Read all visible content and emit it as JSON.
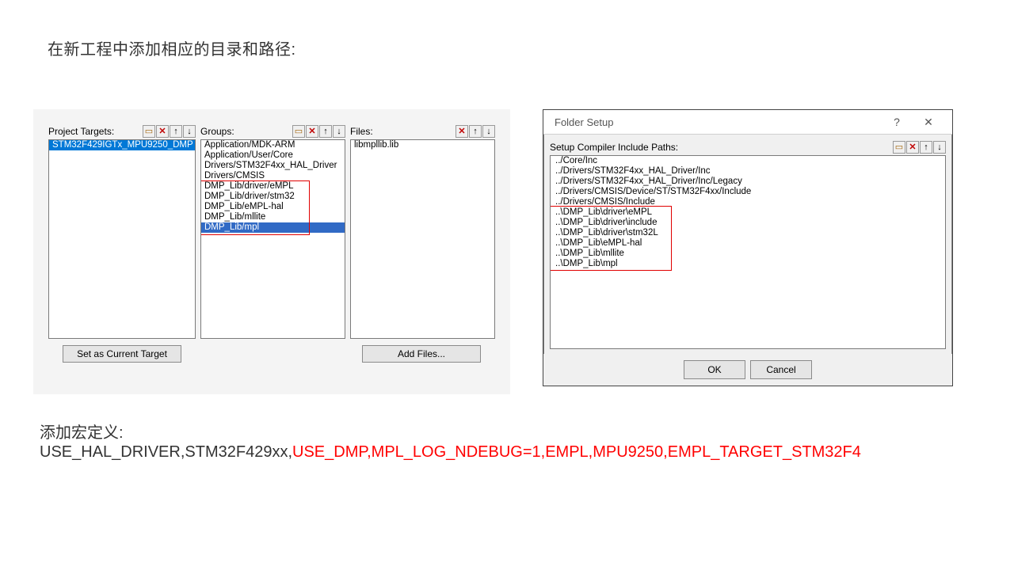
{
  "instruction1": "在新工程中添加相应的目录和路径:",
  "instruction2": "添加宏定义:",
  "macro_black": "USE_HAL_DRIVER,STM32F429xx,",
  "macro_red": "USE_DMP,MPL_LOG_NDEBUG=1,EMPL,MPU9250,EMPL_TARGET_STM32F4",
  "panel1": {
    "targets_label": "Project Targets:",
    "groups_label": "Groups:",
    "files_label": "Files:",
    "targets": [
      "STM32F429IGTx_MPU9250_DMP"
    ],
    "groups": [
      "Application/MDK-ARM",
      "Application/User/Core",
      "Drivers/STM32F4xx_HAL_Driver",
      "Drivers/CMSIS",
      "DMP_Lib/driver/eMPL",
      "DMP_Lib/driver/stm32",
      "DMP_Lib/eMPL-hal",
      "DMP_Lib/mllite",
      "DMP_Lib/mpl"
    ],
    "groups_selected_index": 8,
    "files": [
      "libmpllib.lib"
    ],
    "btn_set_target": "Set as Current Target",
    "btn_add_files": "Add Files..."
  },
  "panel2": {
    "title": "Folder Setup",
    "label": "Setup Compiler Include Paths:",
    "paths": [
      "../Core/Inc",
      "../Drivers/STM32F4xx_HAL_Driver/Inc",
      "../Drivers/STM32F4xx_HAL_Driver/Inc/Legacy",
      "../Drivers/CMSIS/Device/ST/STM32F4xx/Include",
      "../Drivers/CMSIS/Include",
      "..\\DMP_Lib\\driver\\eMPL",
      "..\\DMP_Lib\\driver\\include",
      "..\\DMP_Lib\\driver\\stm32L",
      "..\\DMP_Lib\\eMPL-hal",
      "..\\DMP_Lib\\mllite",
      "..\\DMP_Lib\\mpl"
    ],
    "btn_ok": "OK",
    "btn_cancel": "Cancel"
  },
  "icons": {
    "new": "▭",
    "del": "✕",
    "up": "↑",
    "down": "↓",
    "help": "?",
    "close": "✕"
  }
}
